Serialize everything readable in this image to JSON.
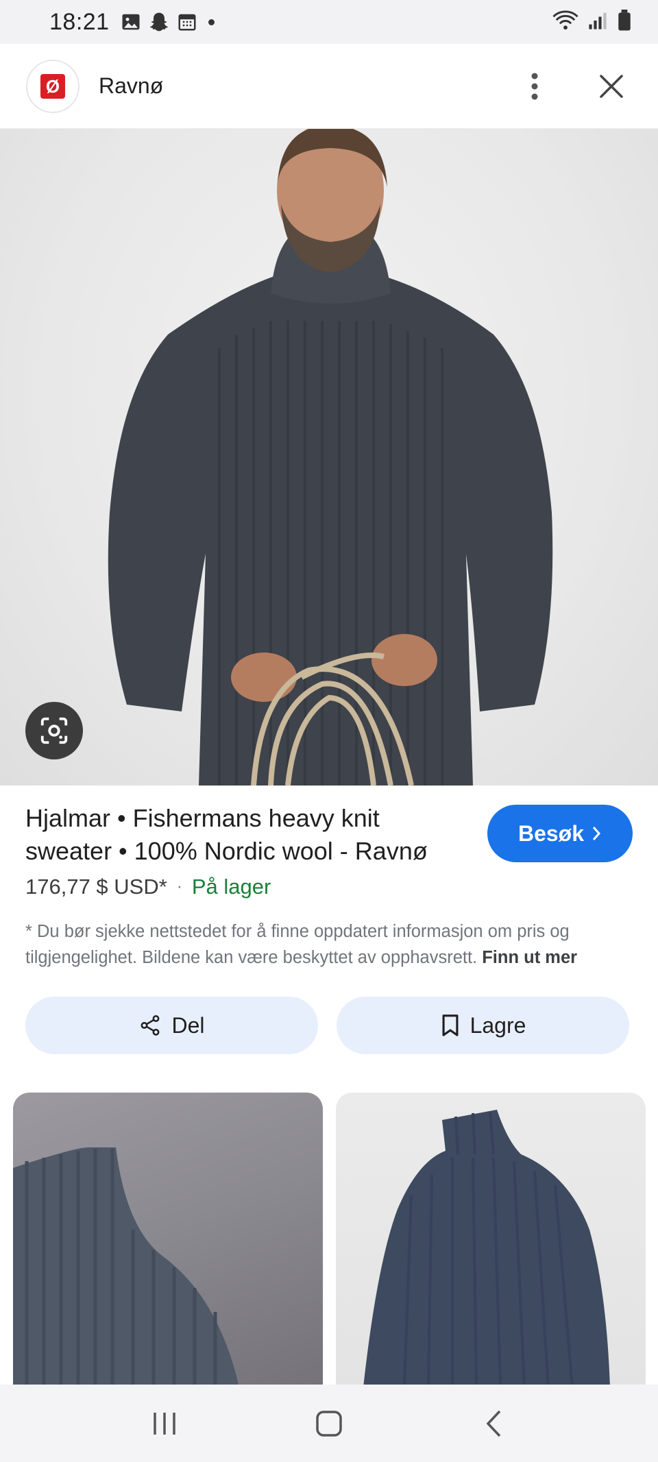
{
  "status_bar": {
    "time": "18:21"
  },
  "header": {
    "site_name": "Ravnø",
    "logo_letter": "Ø",
    "brand_color": "#d81f26"
  },
  "product": {
    "title": "Hjalmar • Fishermans heavy knit sweater • 100% Nordic wool - Ravnø",
    "visit_label": "Besøk",
    "price": "176,77 $ USD*",
    "price_separator": "·",
    "stock_status": "På lager",
    "disclaimer": "* Du bør sjekke nettstedet for å finne oppdatert informasjon om pris og tilgjengelighet. Bildene kan være beskyttet av opphavsrett.",
    "learn_more": "Finn ut mer"
  },
  "actions": {
    "share_label": "Del",
    "save_label": "Lagre"
  },
  "icons": {
    "gallery": "image-icon",
    "snapchat": "snapchat-icon",
    "calendar": "calendar-icon",
    "wifi": "wifi-icon",
    "signal": "signal-icon",
    "battery": "battery-icon",
    "more": "more-vert-icon",
    "close": "close-icon",
    "lens": "google-lens-icon",
    "share": "share-icon",
    "bookmark": "bookmark-icon",
    "recents": "recents-icon",
    "home": "home-icon",
    "back": "back-icon"
  },
  "colors": {
    "accent": "#1a73e8",
    "in_stock": "#188038",
    "action_button_bg": "#e8effc"
  }
}
